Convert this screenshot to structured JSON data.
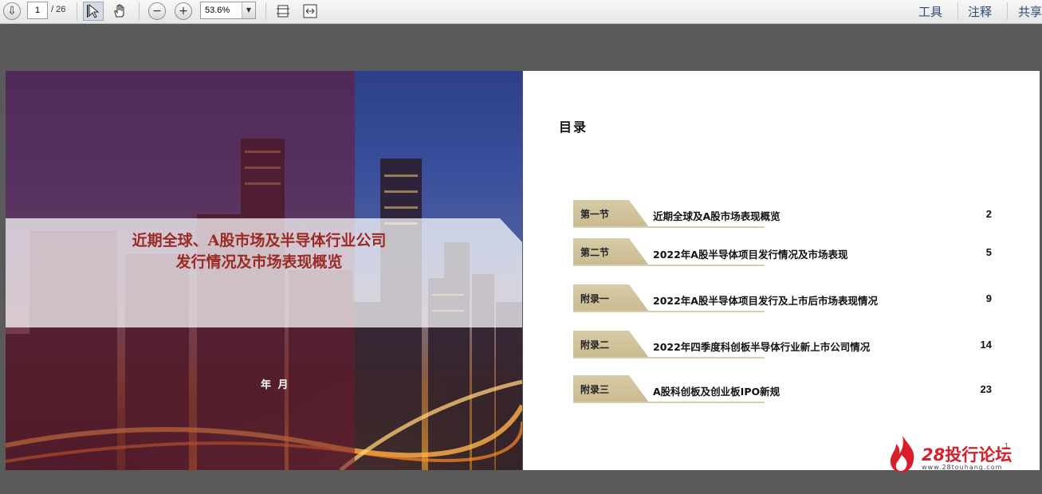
{
  "toolbar": {
    "page_current": "1",
    "page_total": "/ 26",
    "zoom": "53.6%",
    "tools_label": "工具",
    "comment_label": "注释",
    "share_label": "共享"
  },
  "cover": {
    "title_line1": "近期全球、A股市场及半导体行业公司",
    "title_line2": "发行情况及市场表现概览",
    "date": "年 月"
  },
  "toc": {
    "title": "目录",
    "items": [
      {
        "tag": "第一节",
        "text": "近期全球及A股市场表现概览",
        "page": "2"
      },
      {
        "tag": "第二节",
        "text": "2022年A股半导体项目发行情况及市场表现",
        "page": "5"
      },
      {
        "tag": "附录一",
        "text": "2022年A股半导体项目发行及上市后市场表现情况",
        "page": "9"
      },
      {
        "tag": "附录二",
        "text": "2022年四季度科创板半导体行业新上市公司情况",
        "page": "14"
      },
      {
        "tag": "附录三",
        "text": "A股科创板及创业板IPO新规",
        "page": "23"
      }
    ]
  },
  "page_marker": "1",
  "watermark": {
    "name_num": "28",
    "name_text": "投行论坛",
    "url": "www.28touhang.com"
  }
}
